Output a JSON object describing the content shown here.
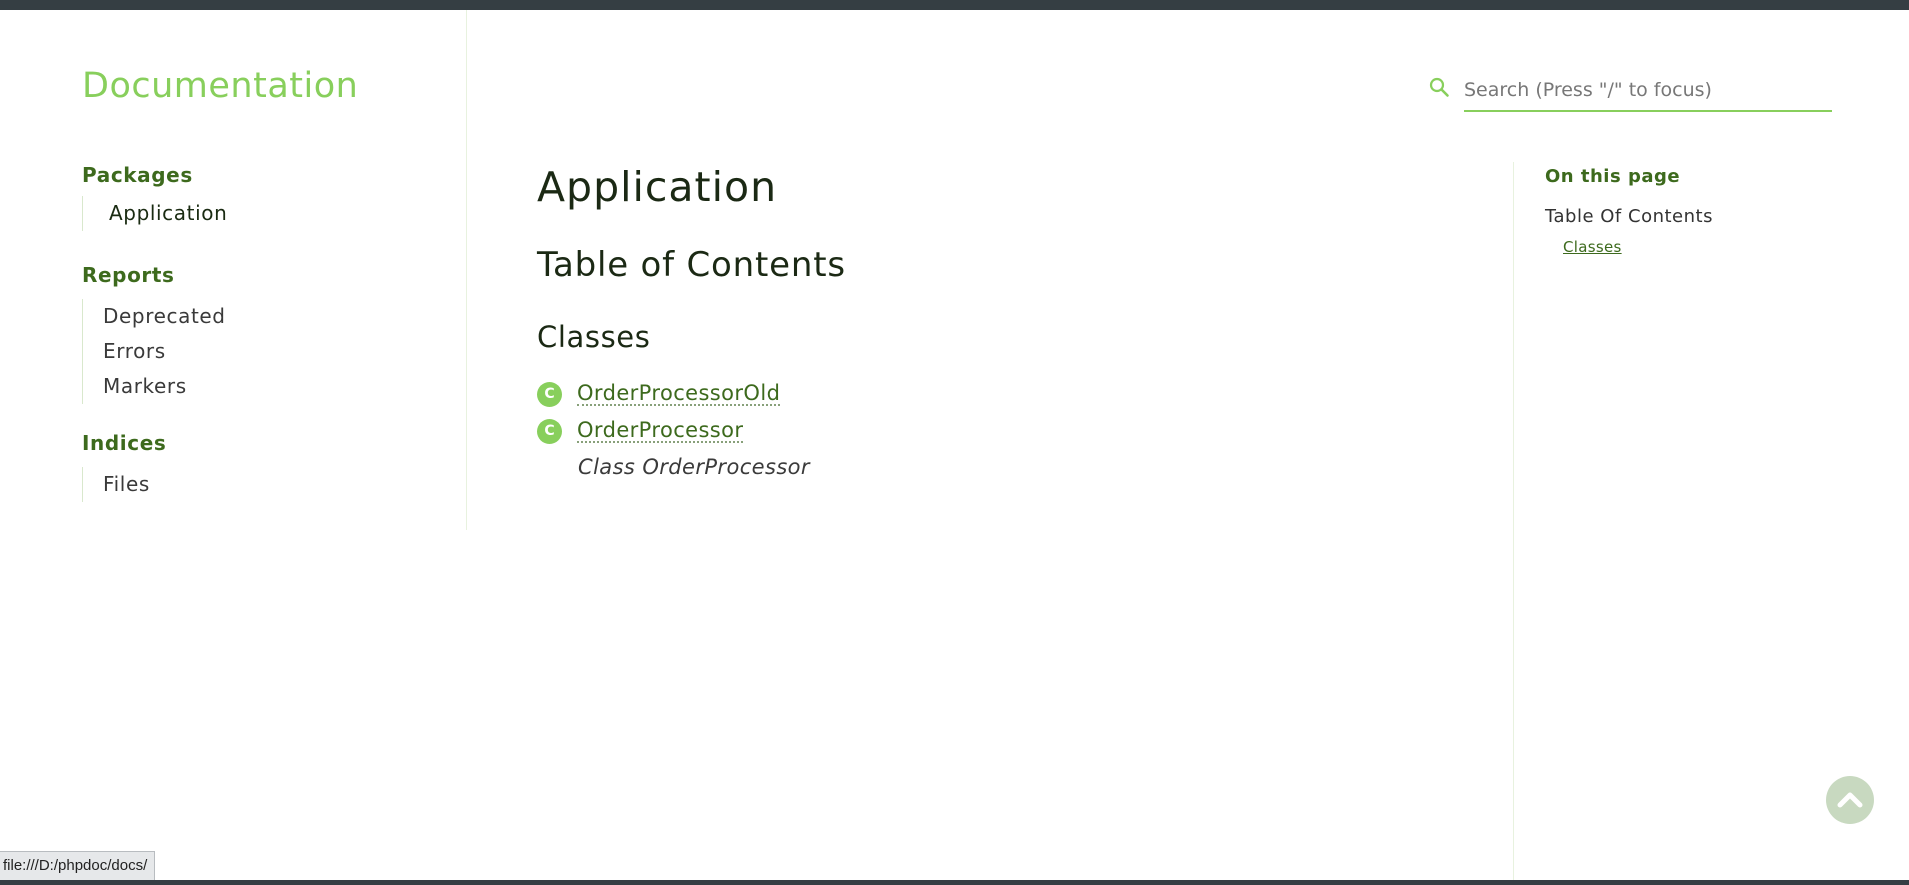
{
  "sidebar": {
    "brand": "Documentation",
    "sections": [
      {
        "title": "Packages",
        "items": [
          "Application"
        ]
      },
      {
        "title": "Reports",
        "items": [
          "Deprecated",
          "Errors",
          "Markers"
        ]
      },
      {
        "title": "Indices",
        "items": [
          "Files"
        ]
      }
    ]
  },
  "search": {
    "placeholder": "Search (Press \"/\" to focus)"
  },
  "main": {
    "title": "Application",
    "toc_heading": "Table of Contents",
    "classes_heading": "Classes",
    "classes": [
      {
        "badge": "C",
        "name": "OrderProcessorOld"
      },
      {
        "badge": "C",
        "name": "OrderProcessor",
        "summary": "Class OrderProcessor"
      }
    ]
  },
  "toc": {
    "title": "On this page",
    "item": "Table Of Contents",
    "link": "Classes"
  },
  "status_bar": {
    "url": "file:///D:/phpdoc/docs/"
  },
  "colors": {
    "accent": "#88cf5c",
    "dark_green": "#3d6a1d",
    "top_bar": "#353e43"
  },
  "icons": {
    "search": "search-icon",
    "back_to_top": "chevron-up-icon"
  }
}
